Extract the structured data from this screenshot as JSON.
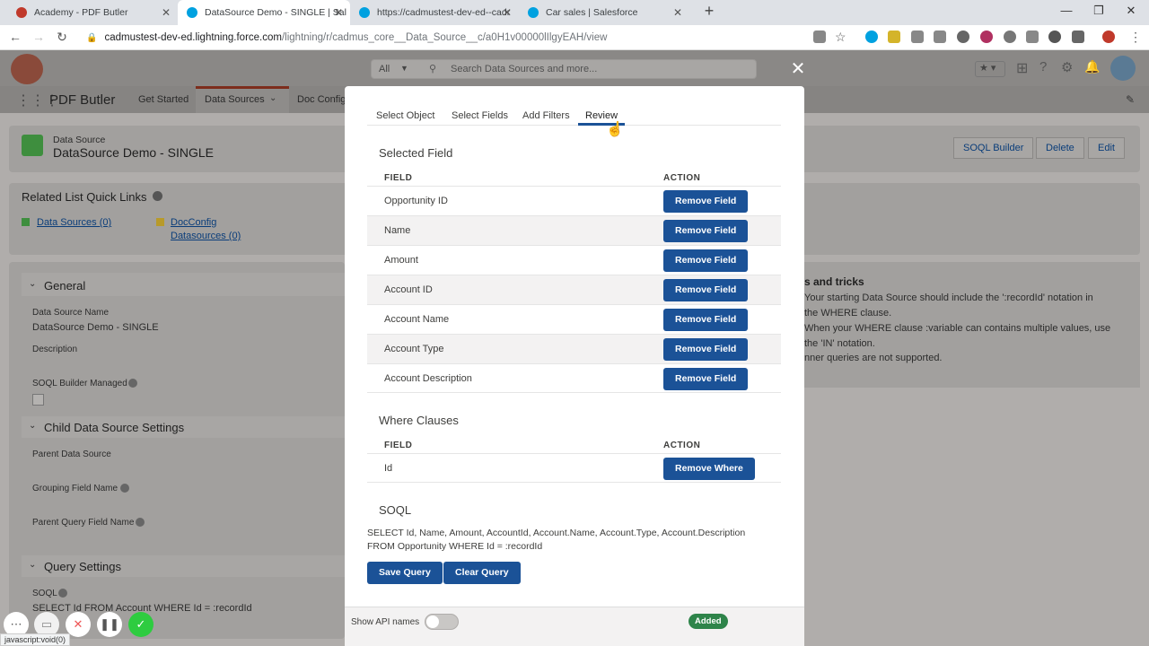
{
  "browser": {
    "tabs": [
      {
        "title": "Academy - PDF Butler",
        "favicon_color": "#c0392b"
      },
      {
        "title": "DataSource Demo - SINGLE | Sal",
        "favicon_color": "#00a1e0"
      },
      {
        "title": "https://cadmustest-dev-ed--cadr",
        "favicon_color": "#00a1e0"
      },
      {
        "title": "Car sales | Salesforce",
        "favicon_color": "#00a1e0"
      }
    ],
    "url_host": "cadmustest-dev-ed.lightning.force.com",
    "url_path": "/lightning/r/cadmus_core__Data_Source__c/a0H1v00000lIlgyEAH/view"
  },
  "sf": {
    "app_name": "PDF Butler",
    "search_scope": "All",
    "search_placeholder": "Search Data Sources and more...",
    "nav": [
      "Get Started",
      "Data Sources",
      "Doc Config"
    ],
    "record_type": "Data Source",
    "record_title": "DataSource Demo - SINGLE",
    "record_buttons": [
      "SOQL Builder",
      "Delete",
      "Edit"
    ],
    "related_title": "Related List Quick Links",
    "related_links": [
      "Data Sources (0)",
      "DocConfig",
      "Datasources (0)"
    ],
    "sections": {
      "general": "General",
      "child": "Child Data Source Settings",
      "query": "Query Settings"
    },
    "fields": {
      "ds_name_label": "Data Source Name",
      "ds_name_value": "DataSource Demo - SINGLE",
      "description_label": "Description",
      "soql_managed_label": "SOQL Builder Managed",
      "parent_ds_label": "Parent Data Source",
      "grouping_label": "Grouping Field Name",
      "parent_query_label": "Parent Query Field Name",
      "soql_label": "SOQL",
      "soql_value": "SELECT Id FROM Account WHERE Id = :recordId"
    },
    "tips": {
      "title": "s and tricks",
      "lines": [
        "Your starting Data Source should include the ':recordId' notation in",
        "the WHERE clause.",
        "When your WHERE clause :variable can contains multiple values, use",
        "the 'IN' notation.",
        "nner queries are not supported."
      ]
    }
  },
  "modal": {
    "tabs": [
      "Select Object",
      "Select Fields",
      "Add Filters",
      "Review"
    ],
    "active_tab": "Review",
    "selected_field_title": "Selected Field",
    "col_field": "FIELD",
    "col_action": "ACTION",
    "fields": [
      "Opportunity ID",
      "Name",
      "Amount",
      "Account ID",
      "Account Name",
      "Account Type",
      "Account Description"
    ],
    "remove_field_label": "Remove Field",
    "where_title": "Where Clauses",
    "where_fields": [
      "Id"
    ],
    "remove_where_label": "Remove Where",
    "soql_title": "SOQL",
    "soql_line1": "SELECT Id, Name, Amount, AccountId, Account.Name, Account.Type, Account.Description",
    "soql_line2": "FROM Opportunity WHERE Id = :recordId",
    "save_query": "Save Query",
    "clear_query": "Clear Query",
    "api_names_label": "Show API names",
    "status_badge": "Added"
  },
  "status_bar": "javascript:void(0)",
  "colors": {
    "brand_button": "#1b5297",
    "success": "#2e844a"
  }
}
